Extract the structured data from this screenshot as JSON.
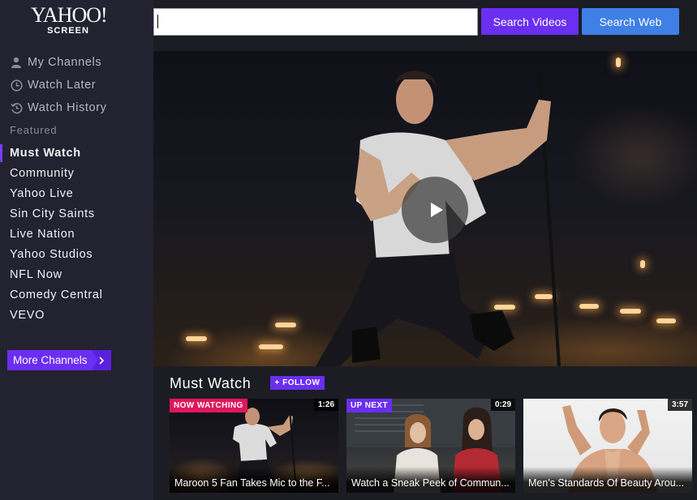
{
  "logo": {
    "brand": "YAHOO!",
    "sub": "SCREEN"
  },
  "sidebar": {
    "menu": [
      {
        "label": "My Channels",
        "icon": "person-icon"
      },
      {
        "label": "Watch Later",
        "icon": "clock-icon"
      },
      {
        "label": "Watch History",
        "icon": "history-icon"
      }
    ],
    "featured_label": "Featured",
    "channels": [
      {
        "label": "Must Watch",
        "active": true
      },
      {
        "label": "Community"
      },
      {
        "label": "Yahoo Live"
      },
      {
        "label": "Sin City Saints"
      },
      {
        "label": "Live Nation"
      },
      {
        "label": "Yahoo Studios"
      },
      {
        "label": "NFL Now"
      },
      {
        "label": "Comedy Central"
      },
      {
        "label": "VEVO"
      }
    ],
    "more_label": "More Channels",
    "more_icon": "chevron-right-icon"
  },
  "search": {
    "value": "",
    "videos_label": "Search Videos",
    "web_label": "Search Web"
  },
  "player": {
    "play_icon": "play-icon"
  },
  "strip": {
    "title": "Must Watch",
    "follow_label": "+ FOLLOW",
    "items": [
      {
        "badge": "NOW WATCHING",
        "badge_color": "#e0165b",
        "duration": "1:26",
        "title": "Maroon 5 Fan Takes Mic to the F..."
      },
      {
        "badge": "UP NEXT",
        "badge_color": "#6a2ff0",
        "duration": "0:29",
        "title": "Watch a Sneak Peek of Commun..."
      },
      {
        "badge": "",
        "badge_color": "",
        "duration": "3:57",
        "title": "Men's Standards Of Beauty Arou..."
      }
    ]
  },
  "colors": {
    "accent": "#6a2ff0",
    "web_button": "#3f7fe6",
    "sidebar_bg": "#232230",
    "page_bg": "#1c1c24"
  }
}
